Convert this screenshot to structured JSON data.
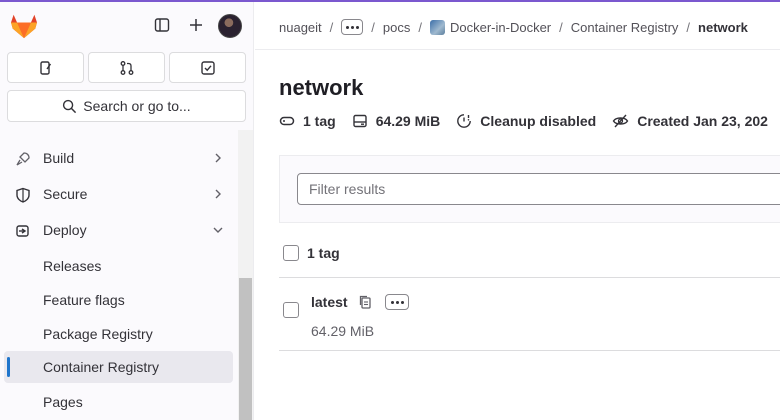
{
  "sidebar": {
    "search_label": "Search or go to...",
    "nav": [
      {
        "label": "Build",
        "icon": "rocket-icon",
        "expandable": true,
        "expanded": false
      },
      {
        "label": "Secure",
        "icon": "shield-icon",
        "expandable": true,
        "expanded": false
      },
      {
        "label": "Deploy",
        "icon": "deployments-icon",
        "expandable": true,
        "expanded": true
      }
    ],
    "deploy_items": [
      "Releases",
      "Feature flags",
      "Package Registry",
      "Container Registry",
      "Pages"
    ],
    "active_item": "Container Registry"
  },
  "breadcrumb": {
    "items": [
      "nuageit",
      "pocs",
      "Docker-in-Docker",
      "Container Registry",
      "network"
    ]
  },
  "page": {
    "title": "network",
    "meta": {
      "tags": "1 tag",
      "size": "64.29 MiB",
      "cleanup": "Cleanup disabled",
      "created": "Created Jan 23, 202"
    }
  },
  "filter": {
    "placeholder": "Filter results"
  },
  "tag_list": {
    "header_label": "1 tag",
    "rows": [
      {
        "name": "latest",
        "size": "64.29 MiB"
      }
    ]
  },
  "colors": {
    "accent": "#1f75cb",
    "brand_top": "#7b58cf",
    "gitlab_orange": "#e24329"
  }
}
